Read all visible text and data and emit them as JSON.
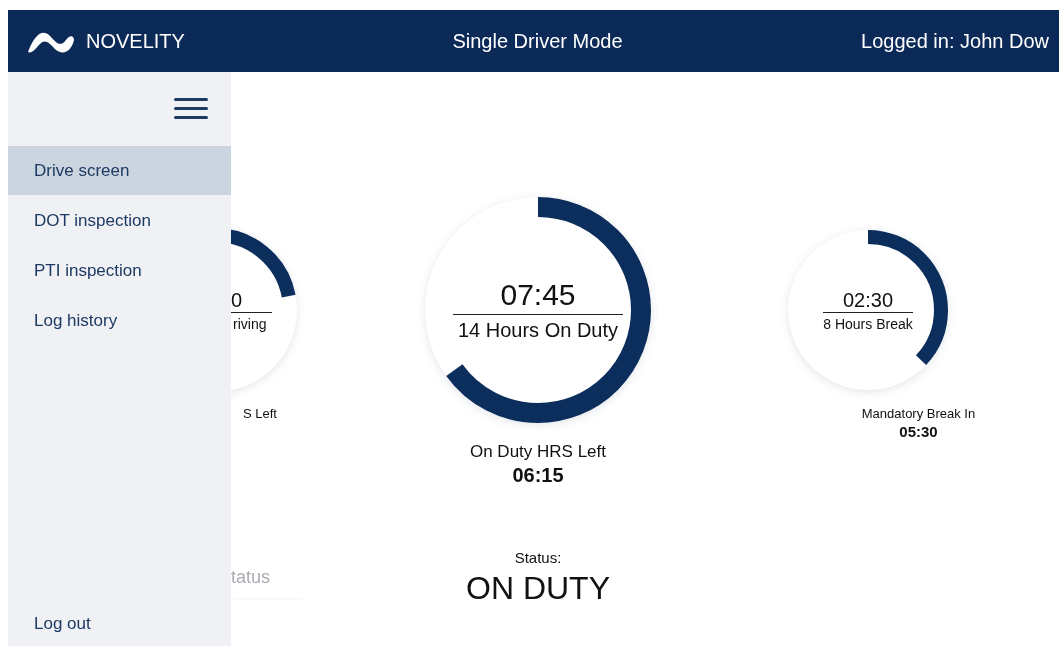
{
  "header": {
    "brand": "NOVELITY",
    "title": "Single Driver Mode",
    "user": "Logged in: John Dow"
  },
  "sidebar": {
    "items": [
      {
        "label": "Drive screen",
        "selected": true
      },
      {
        "label": "DOT inspection",
        "selected": false
      },
      {
        "label": "PTI inspection",
        "selected": false
      },
      {
        "label": "Log history",
        "selected": false
      }
    ],
    "footer_item": "Log out"
  },
  "gauges": [
    {
      "kind": "partial",
      "value": "0",
      "caption": "riving",
      "footer_label": "S Left",
      "level": 0.22
    },
    {
      "kind": "large",
      "value": "07:45",
      "caption": "14 Hours On Duty",
      "footer_label": "On Duty HRS Left",
      "footer_value": "06:15",
      "level": 0.65
    },
    {
      "kind": "small",
      "value": "02:30",
      "caption": "8 Hours Break",
      "footer_label": "Mandatory Break In",
      "footer_value": "05:30",
      "level": 0.37
    }
  ],
  "status_fragment": "tatus",
  "status": {
    "label": "Status:",
    "value": "ON DUTY"
  }
}
